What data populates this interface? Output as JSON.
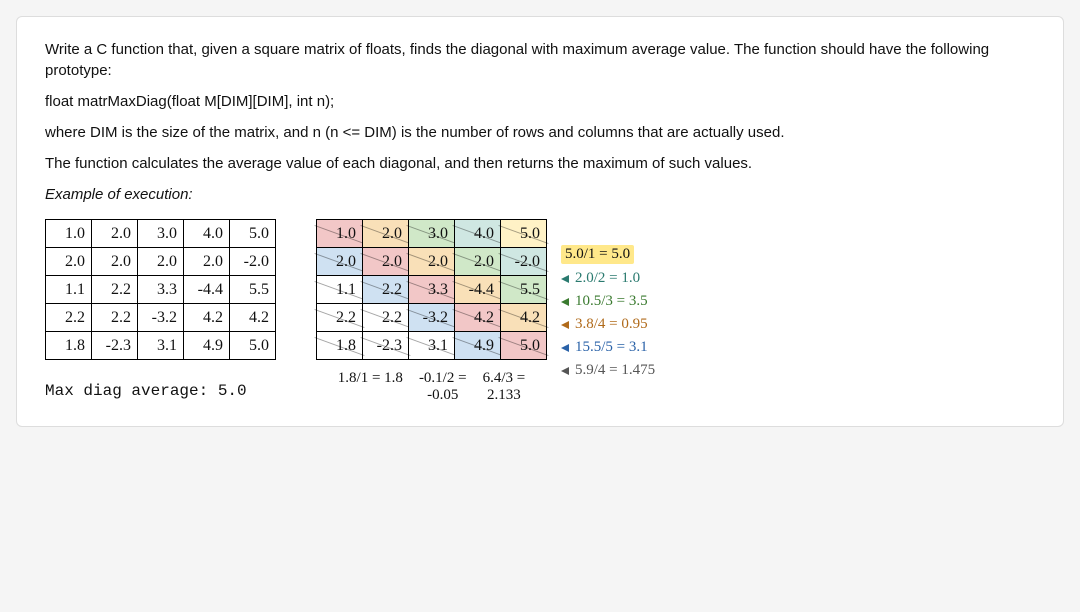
{
  "prose": {
    "p1": "Write a C function that, given a square matrix of floats, finds the diagonal with maximum average value. The function should have the following prototype:",
    "proto": "float matrMaxDiag(float M[DIM][DIM], int n);",
    "p2": "where DIM is the size of the matrix, and n (n <= DIM) is the number of rows and columns that are actually used.",
    "p3": "The function calculates the average value of each diagonal, and then returns the maximum of such values.",
    "example_label": "Example of execution:"
  },
  "matrix": [
    [
      "1.0",
      "2.0",
      "3.0",
      "4.0",
      "5.0"
    ],
    [
      "2.0",
      "2.0",
      "2.0",
      "2.0",
      "-2.0"
    ],
    [
      "1.1",
      "2.2",
      "3.3",
      "-4.4",
      "5.5"
    ],
    [
      "2.2",
      "2.2",
      "-3.2",
      "4.2",
      "4.2"
    ],
    [
      "1.8",
      "-2.3",
      "3.1",
      "4.9",
      "5.0"
    ]
  ],
  "result_line": "Max diag average: 5.0",
  "legend": {
    "r0": "5.0/1 = 5.0",
    "r1": "2.0/2 = 1.0",
    "r2": "10.5/3 = 3.5",
    "r3": "3.8/4 = 0.95",
    "r4": "15.5/5 = 3.1",
    "r5": "5.9/4 = 1.475"
  },
  "below": {
    "b1": "1.8/1 = 1.8",
    "b2_top": "-0.1/2 =",
    "b2_bot": "-0.05",
    "b3_top": "6.4/3 =",
    "b3_bot": "2.133"
  }
}
